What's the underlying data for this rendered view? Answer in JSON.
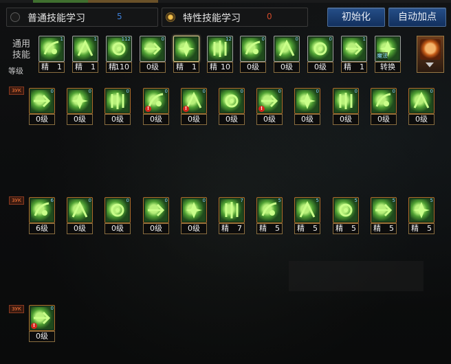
{
  "tabs": [
    {
      "label": "普通技能学习",
      "count": "5",
      "selected": false,
      "count_color": "#3d7fd8"
    },
    {
      "label": "特性技能学习",
      "count": "0",
      "selected": true,
      "count_color": "#d04a2a"
    }
  ],
  "buttons": {
    "reset_label": "初始化",
    "auto_label": "自动加点"
  },
  "side_labels": {
    "common_skills": "通用\n技能",
    "level": "等级"
  },
  "row_tag": "ЗУК",
  "common_skills": [
    {
      "icon": "figure-kneel-icon",
      "num": "1",
      "level": "精 1",
      "split": true
    },
    {
      "icon": "eagle-claw-icon",
      "num": "1",
      "level": "精 1",
      "split": true
    },
    {
      "icon": "dash-strike-icon",
      "num": "112",
      "level": "精 110",
      "split": true
    },
    {
      "icon": "wings-icon",
      "num": "0",
      "level": "0级",
      "split": false
    },
    {
      "icon": "figure-sit-icon",
      "num": "",
      "level": "精 1",
      "split": true,
      "selected": true
    },
    {
      "icon": "target-icon",
      "num": "12",
      "level": "精 10",
      "split": true
    },
    {
      "icon": "beast-icon",
      "num": "0",
      "level": "0级",
      "split": false
    },
    {
      "icon": "eye-ring-icon",
      "num": "0",
      "level": "0级",
      "split": false
    },
    {
      "icon": "person-glow-icon",
      "num": "0",
      "level": "0级",
      "split": false
    },
    {
      "icon": "burst-icon",
      "num": "1",
      "level": "精 1",
      "split": true
    },
    {
      "icon": "rune-convert-icon",
      "num": "",
      "level": "转换",
      "split": false,
      "badge": "魔法"
    }
  ],
  "row1_skills": [
    {
      "icon": "kick-icon",
      "num": "0",
      "level": "0级"
    },
    {
      "icon": "slash-arc-icon",
      "num": "0",
      "level": "0级"
    },
    {
      "icon": "arrow-dash-icon",
      "num": "0",
      "level": "0级"
    },
    {
      "icon": "flame-figure-icon",
      "num": "0",
      "level": "0级",
      "warn": true
    },
    {
      "icon": "orb-tail-icon",
      "num": "0",
      "level": "0级",
      "warn": true
    },
    {
      "icon": "comet-icon",
      "num": "0",
      "level": "0级"
    },
    {
      "icon": "whip-icon",
      "num": "0",
      "level": "0级",
      "warn": true
    },
    {
      "icon": "knot-icon",
      "num": "0",
      "level": "0级"
    },
    {
      "icon": "spin-kick-icon",
      "num": "0",
      "level": "0级"
    },
    {
      "icon": "hat-figure-icon",
      "num": "0",
      "level": "0级"
    },
    {
      "icon": "lasso-icon",
      "num": "0",
      "level": "0级"
    }
  ],
  "row2_skills": [
    {
      "icon": "fist-icon",
      "num": "6",
      "level": "6级",
      "split": false
    },
    {
      "icon": "moon-sparks-icon",
      "num": "0",
      "level": "0级",
      "split": false
    },
    {
      "icon": "pillar-icon",
      "num": "0",
      "level": "0级",
      "split": false
    },
    {
      "icon": "sun-ring-icon",
      "num": "0",
      "level": "0级",
      "split": false
    },
    {
      "icon": "vortex-icon",
      "num": "0",
      "level": "0级",
      "split": false
    },
    {
      "icon": "columns-icon",
      "num": "7",
      "level": "精 7",
      "split": true
    },
    {
      "icon": "rising-strike-icon",
      "num": "5",
      "level": "精 5",
      "split": true
    },
    {
      "icon": "swirl-icon",
      "num": "5",
      "level": "精 5",
      "split": true
    },
    {
      "icon": "crystal-burst-icon",
      "num": "5",
      "level": "精 5",
      "split": true
    },
    {
      "icon": "leap-icon",
      "num": "5",
      "level": "精 5",
      "split": true
    },
    {
      "icon": "bars-icon",
      "num": "5",
      "level": "精 5",
      "split": true
    }
  ],
  "row3_skills": [
    {
      "icon": "thorn-pillar-icon",
      "num": "0",
      "level": "0级",
      "warn": true
    }
  ]
}
